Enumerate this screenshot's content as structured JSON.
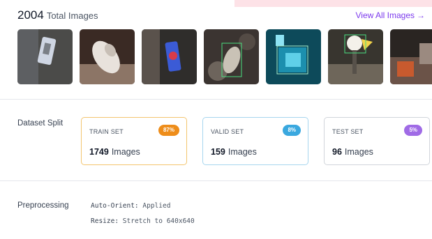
{
  "header": {
    "total_count": "2004",
    "total_label": "Total Images",
    "view_all_label": "View All Images",
    "view_all_arrow": "→"
  },
  "thumbnails": [
    {
      "name": "thumbnail-1",
      "colors": [
        "#4b4b49",
        "#7a7f86",
        "#cfd6e3"
      ]
    },
    {
      "name": "thumbnail-2",
      "colors": [
        "#3a2a24",
        "#8c7566",
        "#e8e2dc"
      ]
    },
    {
      "name": "thumbnail-3",
      "colors": [
        "#2f2d2b",
        "#5a524c",
        "#3b5bd6"
      ]
    },
    {
      "name": "thumbnail-4",
      "colors": [
        "#3b3431",
        "#6d645c",
        "#c9c2b6"
      ]
    },
    {
      "name": "thumbnail-5",
      "colors": [
        "#0d4a5a",
        "#1c8fae",
        "#5fd0e8"
      ]
    },
    {
      "name": "thumbnail-6",
      "colors": [
        "#38352f",
        "#6e665a",
        "#f2d44a"
      ]
    },
    {
      "name": "thumbnail-7",
      "colors": [
        "#2a2522",
        "#6b5348",
        "#c85a2e"
      ]
    }
  ],
  "dataset_split": {
    "label": "Dataset Split",
    "cards": [
      {
        "title": "TRAIN SET",
        "percent": "87%",
        "count": "1749",
        "unit": "Images",
        "badge_color": "#ee8d1a",
        "border_color": "#f3c56f"
      },
      {
        "title": "VALID SET",
        "percent": "8%",
        "count": "159",
        "unit": "Images",
        "badge_color": "#3aa8df",
        "border_color": "#a7d6ef"
      },
      {
        "title": "TEST SET",
        "percent": "5%",
        "count": "96",
        "unit": "Images",
        "badge_color": "#a06be6",
        "border_color": "#d1d5db"
      }
    ]
  },
  "preprocessing": {
    "label": "Preprocessing",
    "steps": [
      {
        "name": "Auto-Orient:",
        "value": "Applied"
      },
      {
        "name": "Resize:",
        "value": "Stretch to 640x640"
      }
    ]
  }
}
